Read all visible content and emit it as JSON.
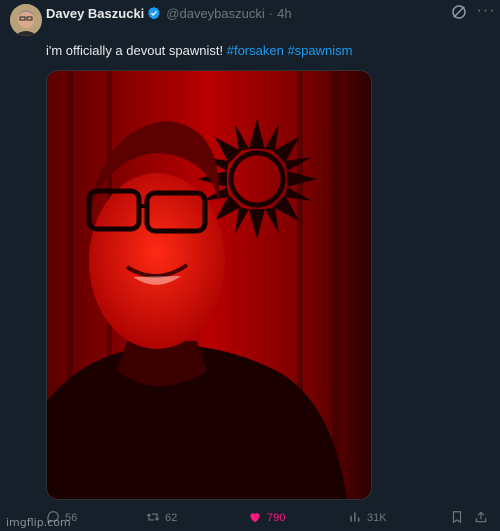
{
  "author": {
    "name": "Davey Baszucki",
    "handle": "@daveybaszucki",
    "separator": "·",
    "time": "4h",
    "verified": true
  },
  "tweet": {
    "text": "i'm officially a devout spawnist!",
    "hashtags": [
      "#forsaken",
      "#spawnism"
    ]
  },
  "actions": {
    "replies": "56",
    "retweets": "62",
    "likes": "790",
    "views": "31K"
  },
  "icons": {
    "grok": "grok-icon",
    "more": "more-icon",
    "reply": "reply-icon",
    "retweet": "retweet-icon",
    "like": "heart-icon",
    "views": "views-icon",
    "bookmark": "bookmark-icon",
    "share": "share-icon"
  },
  "colors": {
    "background": "#15202b",
    "accent": "#1d9bf0",
    "like": "#f91880",
    "muted": "#71767b"
  },
  "watermark": "imgflip.com"
}
